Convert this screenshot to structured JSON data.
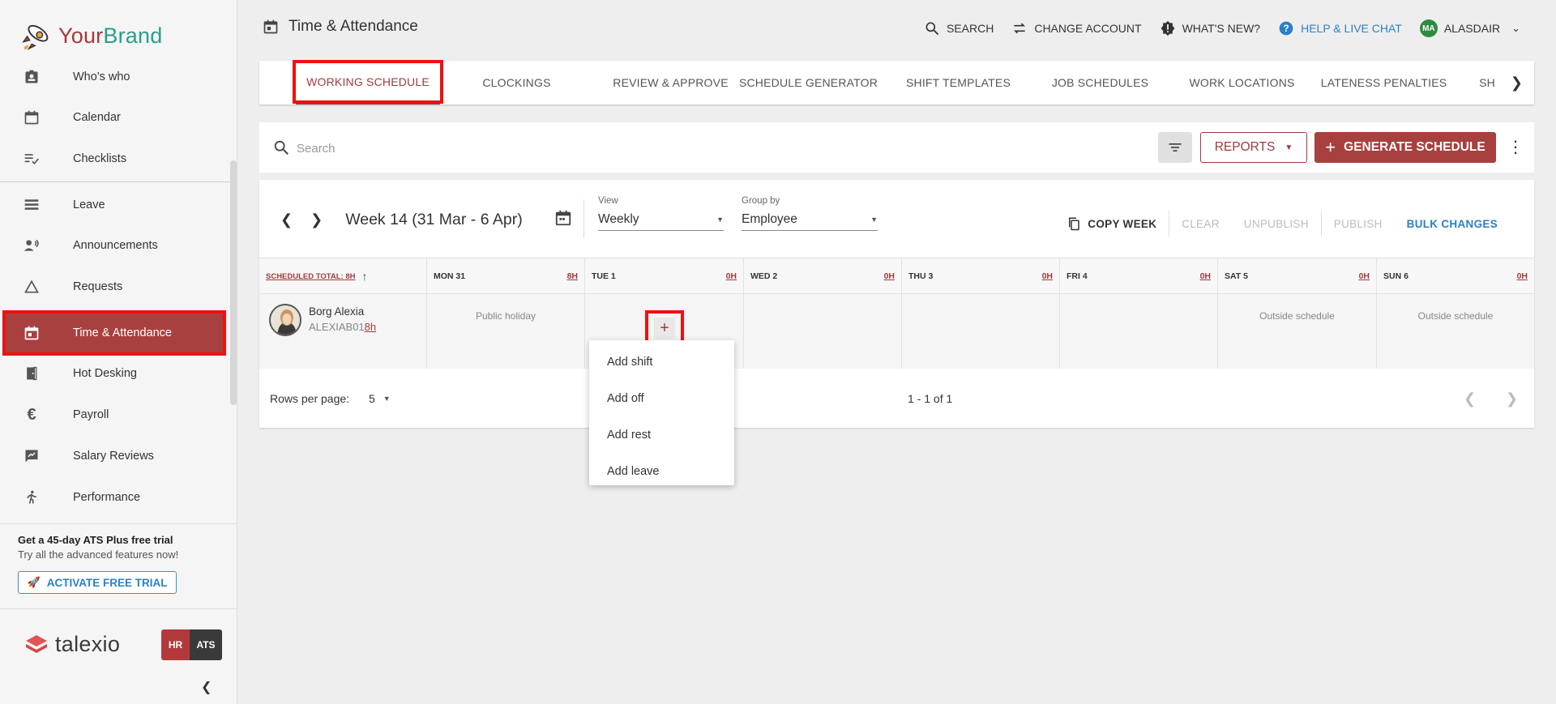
{
  "brand": {
    "part1": "Your",
    "part2": "Brand"
  },
  "sidebar": {
    "items": [
      {
        "label": "Who's who",
        "icon": "badge-icon"
      },
      {
        "label": "Calendar",
        "icon": "calendar-icon"
      },
      {
        "label": "Checklists",
        "icon": "checklist-icon"
      },
      {
        "label": "Leave",
        "icon": "leave-icon"
      },
      {
        "label": "Announcements",
        "icon": "megaphone-icon"
      },
      {
        "label": "Requests",
        "icon": "triangle-icon"
      },
      {
        "label": "Time & Attendance",
        "icon": "calendar-today-icon"
      },
      {
        "label": "Hot Desking",
        "icon": "door-icon"
      },
      {
        "label": "Payroll",
        "icon": "euro-icon"
      },
      {
        "label": "Salary Reviews",
        "icon": "rate-review-icon"
      },
      {
        "label": "Performance",
        "icon": "running-icon"
      }
    ],
    "trial_title": "Get a 45-day ATS Plus free trial",
    "trial_sub": "Try all the advanced features now!",
    "trial_button": "ACTIVATE FREE TRIAL",
    "product_logo": "talexio",
    "hr_badge": "HR",
    "ats_badge": "ATS"
  },
  "header": {
    "title": "Time & Attendance",
    "search": "SEARCH",
    "change_account": "CHANGE ACCOUNT",
    "whats_new": "WHAT'S NEW?",
    "help": "HELP & LIVE CHAT",
    "avatar_initials": "MA",
    "user": "ALASDAIR"
  },
  "tabs": [
    "WORKING SCHEDULE",
    "CLOCKINGS",
    "REVIEW & APPROVE",
    "SCHEDULE GENERATOR",
    "SHIFT TEMPLATES",
    "JOB SCHEDULES",
    "WORK LOCATIONS",
    "LATENESS PENALTIES",
    "SH"
  ],
  "toolbar": {
    "search_placeholder": "Search",
    "reports": "REPORTS",
    "generate": "GENERATE SCHEDULE"
  },
  "schedule": {
    "week_label": "Week 14 (31 Mar - 6 Apr)",
    "view_caption": "View",
    "view_value": "Weekly",
    "group_caption": "Group by",
    "group_value": "Employee",
    "copy_week": "COPY WEEK",
    "clear": "CLEAR",
    "unpublish": "UNPUBLISH",
    "publish": "PUBLISH",
    "bulk_changes": "BULK CHANGES",
    "total_header": "SCHEDULED TOTAL: 8H",
    "days": [
      {
        "label": "MON 31",
        "hours": "8H"
      },
      {
        "label": "TUE 1",
        "hours": "0H"
      },
      {
        "label": "WED 2",
        "hours": "0H"
      },
      {
        "label": "THU 3",
        "hours": "0H"
      },
      {
        "label": "FRI 4",
        "hours": "0H"
      },
      {
        "label": "SAT 5",
        "hours": "0H"
      },
      {
        "label": "SUN 6",
        "hours": "0H"
      }
    ],
    "employee": {
      "name": "Borg Alexia",
      "code": "ALEXIAB01",
      "hours": "8h"
    },
    "cells": [
      "Public holiday",
      "",
      "",
      "",
      "",
      "Outside schedule",
      "Outside schedule"
    ],
    "rows_per_page_label": "Rows per page:",
    "rows_per_page": "5",
    "range": "1 - 1 of 1"
  },
  "menu": [
    "Add shift",
    "Add off",
    "Add rest",
    "Add leave"
  ],
  "colors": {
    "brand_red": "#a8403f",
    "accent_blue": "#2b7fc8",
    "highlight": "#ee1111"
  }
}
